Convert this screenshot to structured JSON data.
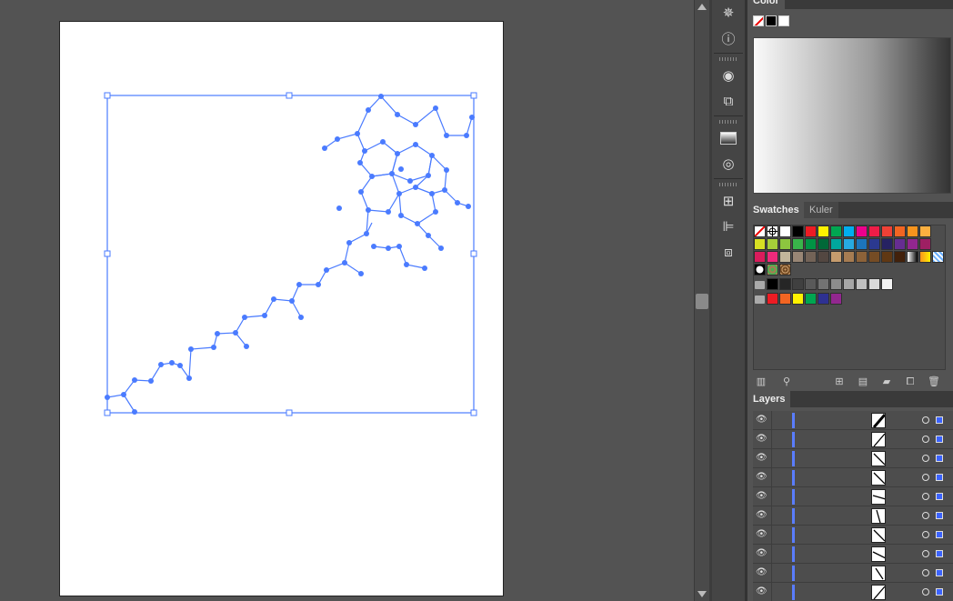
{
  "panels": {
    "color": {
      "title": "Color",
      "fill_none_icon": "none-swatch-icon",
      "black": "#000000",
      "white": "#ffffff"
    },
    "swatches": {
      "tab_active": "Swatches",
      "tab_inactive": "Kuler",
      "rows": [
        [
          "none",
          "registration",
          "#ffffff",
          "#000000",
          "#ed1c24",
          "#fff200",
          "#00a651",
          "#00aeef",
          "#ec008c",
          "#ee1d47",
          "#ef4136",
          "#f26522",
          "#f7941d",
          "#fbb040"
        ],
        [
          "#d7df23",
          "#a6ce39",
          "#8dc63f",
          "#39b54a",
          "#009444",
          "#006838",
          "#00a79d",
          "#27aae1",
          "#1c75bc",
          "#2b3990",
          "#262262",
          "#662d91",
          "#92278f",
          "#9e1f63"
        ],
        [
          "#da1c5c",
          "#ee2a7b",
          "#c2b59b",
          "#998675",
          "#736357",
          "#534741",
          "#c69c6d",
          "#a67c52",
          "#8c6239",
          "#754c24",
          "#603813",
          "#42210b",
          "gradient-bw",
          "gradient-orange",
          "pattern-blue"
        ],
        [
          "pattern-circles",
          "pattern-leaves",
          "pattern-dots"
        ],
        [
          "#000000",
          "#262626",
          "#404040",
          "#595959",
          "#737373",
          "#8c8c8c",
          "#a6a6a6",
          "#bfbfbf",
          "#d9d9d9",
          "#f2f2f2"
        ],
        [
          "#ed1c24",
          "#f26522",
          "#fff200",
          "#00a651",
          "#2e3192",
          "#92278f"
        ]
      ]
    },
    "layers": {
      "title": "Layers",
      "rows": [
        {
          "thumb": "diag-thick"
        },
        {
          "thumb": "diag-up"
        },
        {
          "thumb": "diag-down"
        },
        {
          "thumb": "diag-down"
        },
        {
          "thumb": "flat"
        },
        {
          "thumb": "steep"
        },
        {
          "thumb": "diag-down"
        },
        {
          "thumb": "diag-down-shallow"
        },
        {
          "thumb": "steep-down"
        },
        {
          "thumb": "diag-up"
        }
      ]
    }
  },
  "toolstrip": {
    "icons": [
      "color-guide-icon",
      "info-icon",
      "appearance-icon",
      "transform-icon",
      "gradient-icon",
      "transparency-icon",
      "artboards-icon",
      "align-icon",
      "pathfinder-icon"
    ]
  },
  "accent": "#4a7bff"
}
